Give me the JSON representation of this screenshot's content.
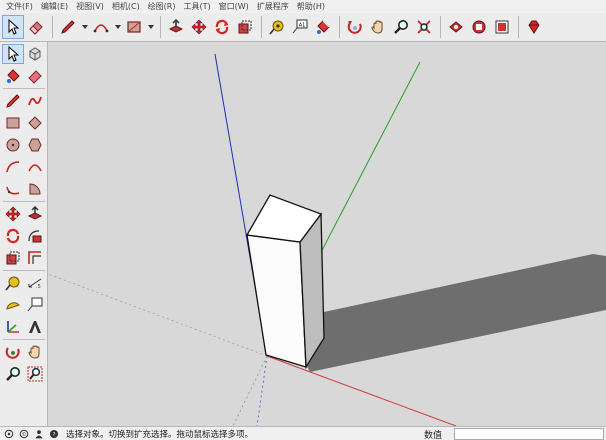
{
  "menubar": {
    "items": [
      "文件(F)",
      "编辑(E)",
      "视图(V)",
      "相机(C)",
      "绘图(R)",
      "工具(T)",
      "窗口(W)",
      "扩展程序",
      "帮助(H)"
    ]
  },
  "toolbar": {
    "icons": [
      "select-icon",
      "eraser-icon",
      "pencil-icon",
      "dropdown",
      "arc-icon",
      "dropdown",
      "rectangle-icon",
      "dropdown",
      "push-pull-icon",
      "move-icon",
      "rotate-icon",
      "scale-icon",
      "tape-measure-icon",
      "text-icon",
      "paint-bucket-icon",
      "orbit-icon",
      "pan-icon",
      "zoom-icon",
      "zoom-extents-icon",
      "3d-warehouse-icon",
      "extension-warehouse-icon",
      "layout-icon",
      "ruby-icon"
    ]
  },
  "lefttools": {
    "rows": [
      [
        "select-icon",
        "component-icon"
      ],
      [
        "paint-bucket-icon",
        "eraser-icon"
      ],
      [
        "pencil-icon",
        "freehand-icon"
      ],
      [
        "rectangle-icon",
        "rotated-rectangle-icon"
      ],
      [
        "circle-icon",
        "polygon-icon"
      ],
      [
        "arc-icon",
        "two-point-arc-icon"
      ],
      [
        "three-point-arc-icon",
        "pie-icon"
      ],
      [
        "move-icon",
        "push-pull-icon"
      ],
      [
        "rotate-icon",
        "follow-me-icon"
      ],
      [
        "scale-icon",
        "offset-icon"
      ],
      [
        "tape-measure-icon",
        "dimension-icon"
      ],
      [
        "protractor-icon",
        "text-icon"
      ],
      [
        "axes-icon",
        "3d-text-icon"
      ],
      [
        "orbit-icon",
        "pan-icon"
      ],
      [
        "zoom-icon",
        "zoom-window-icon"
      ]
    ]
  },
  "statusbar": {
    "text": "选择对象。切换到扩充选择。拖动鼠标选择多项。",
    "measure_label": "数值",
    "measure_value": ""
  },
  "colors": {
    "axis_blue": "#1c2fb8",
    "axis_green": "#27a02a",
    "axis_red": "#d23a3a",
    "shadow": "#6e6e6e",
    "viewport_bg": "#d8d8d8",
    "selected_tool": "#cfe4f7"
  }
}
